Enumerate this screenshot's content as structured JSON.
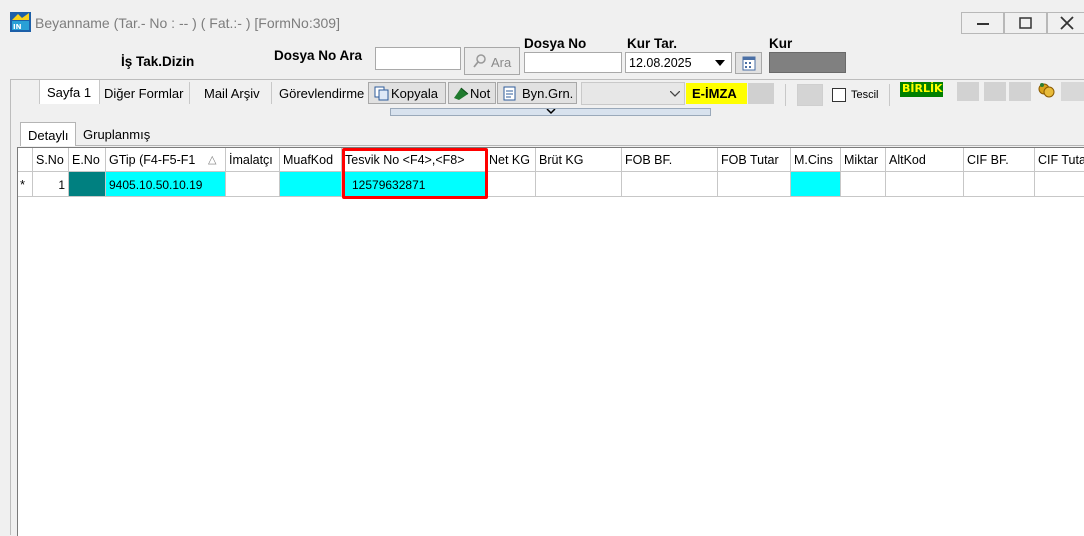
{
  "window": {
    "title": "Beyanname (Tar.- No : -- ) ( Fat.:- ) [FormNo:309]",
    "minimize": "minimize",
    "maximize": "maximize",
    "close": "close"
  },
  "header": {
    "is_takip_dizin": "İş Tak.Dizin",
    "dosya_no_ara_label": "Dosya No Ara",
    "dosya_no_ara_value": "",
    "ara_button": "Ara",
    "dosya_no_label": "Dosya No",
    "dosya_no_value": "",
    "kur_tar_label": "Kur Tar.",
    "kur_tar_value": "12.08.2025",
    "kur_label": "Kur"
  },
  "toolbar": {
    "sayfa1": "Sayfa 1",
    "diger_formlar": "Diğer Formlar",
    "mail_arsiv": "Mail Arşiv",
    "gorevlendirme": "Görevlendirme",
    "kopyala": "Kopyala",
    "not": "Not",
    "byn_grn": "Byn.Grn.",
    "combo_value": "",
    "e_imza": "E-İMZA",
    "tescil": "Tescil",
    "birlik": "BİRLİK"
  },
  "view_tabs": [
    "Detaylı",
    "Gruplanmış"
  ],
  "grid": {
    "columns": [
      "S.No",
      "E.No",
      "GTip (F4-F5-F1",
      "İmalatçı",
      "MuafKod",
      "Tesvik No <F4>,<F8>",
      "Net KG",
      "Brüt KG",
      "FOB BF.",
      "FOB Tutar",
      "M.Cins",
      "Miktar",
      "AltKod",
      "CIF BF.",
      "CIF Tutar"
    ],
    "sort_indicator": "△",
    "rows": [
      {
        "marker": "*",
        "sno": "1",
        "eno": "",
        "gtip": "9405.10.50.10.19",
        "imalatci": "",
        "muafkod": "",
        "tesvik": "12579632871",
        "netkg": "",
        "brutkg": "",
        "fobbf": "",
        "fobtutar": "",
        "mcins": "",
        "miktar": "",
        "altkod": "",
        "cifbf": "",
        "ciftutar": ""
      }
    ]
  },
  "colors": {
    "highlight_border": "#ff0000",
    "cyan": "#00ffff",
    "teal": "#008080",
    "eimza_bg": "#ffff00",
    "birlik_bg": "#008000"
  }
}
